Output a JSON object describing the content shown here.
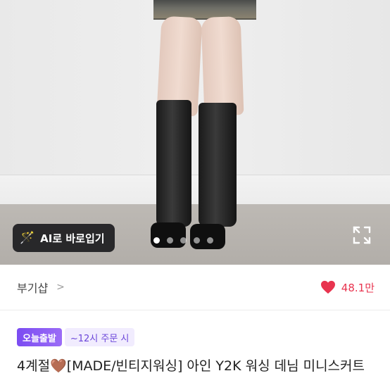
{
  "photo": {
    "ai_button_label": "AI로 바로입기",
    "ai_icon": "magic-wand-icon",
    "carousel": {
      "count": 5,
      "active_index": 0
    },
    "expand_icon": "expand-icon"
  },
  "shop": {
    "name": "부기샵",
    "chevron": ">",
    "like_count": "48.1만",
    "heart_color": "#e8344f"
  },
  "badges": {
    "today_shipping": "오늘출발",
    "order_deadline": "~12시 주문 시"
  },
  "product": {
    "title": "4계절🤎[MADE/빈티지워싱] 아인 Y2K 워싱 데님 미니스커트"
  },
  "colors": {
    "accent_purple": "#7b4cf2",
    "like_red": "#e8344f"
  }
}
